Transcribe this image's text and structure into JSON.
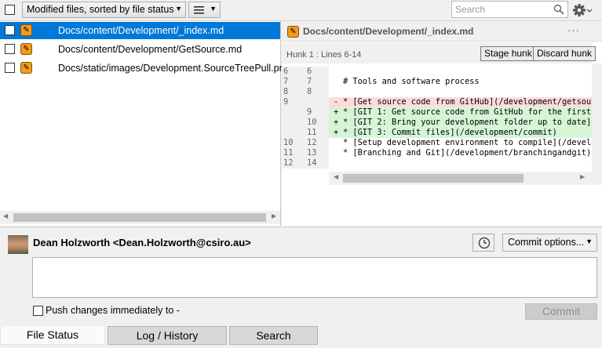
{
  "toolbar": {
    "filter_label": "Modified files, sorted by file status",
    "view_mode_icon": "list-icon",
    "search_placeholder": "Search",
    "settings_icon": "gear-icon"
  },
  "files": [
    {
      "path": "Docs/content/Development/_index.md",
      "status": "modified",
      "selected": true
    },
    {
      "path": "Docs/content/Development/GetSource.md",
      "status": "modified",
      "selected": false
    },
    {
      "path": "Docs/static/images/Development.SourceTreePull.png",
      "status": "modified",
      "selected": false
    }
  ],
  "diff": {
    "file_path": "Docs/content/Development/_index.md",
    "more_label": "···",
    "hunk_label": "Hunk 1 : Lines 6-14",
    "stage_hunk_label": "Stage hunk",
    "discard_hunk_label": "Discard hunk",
    "lines": [
      {
        "old": "6",
        "new": "6",
        "marker": "",
        "type": "context",
        "text": ""
      },
      {
        "old": "7",
        "new": "7",
        "marker": "",
        "type": "context",
        "text": "# Tools and software process"
      },
      {
        "old": "8",
        "new": "8",
        "marker": "",
        "type": "context",
        "text": ""
      },
      {
        "old": "9",
        "new": "",
        "marker": "-",
        "type": "del",
        "text": "* [Get source code from GitHub](/development/getsour"
      },
      {
        "old": "",
        "new": "9",
        "marker": "+",
        "type": "add",
        "text": "* [GIT 1: Get source code from GitHub for the first"
      },
      {
        "old": "",
        "new": "10",
        "marker": "+",
        "type": "add",
        "text": "* [GIT 2: Bring your development folder up to date]("
      },
      {
        "old": "",
        "new": "11",
        "marker": "+",
        "type": "add",
        "text": "* [GIT 3: Commit files](/development/commit)"
      },
      {
        "old": "10",
        "new": "12",
        "marker": "",
        "type": "context",
        "text": "* [Setup development environment to compile](/develo"
      },
      {
        "old": "11",
        "new": "13",
        "marker": "",
        "type": "context",
        "text": "* [Branching and Git](/development/branchingandgit)"
      },
      {
        "old": "12",
        "new": "14",
        "marker": "",
        "type": "context",
        "text": ""
      }
    ]
  },
  "commit": {
    "author": "Dean Holzworth <Dean.Holzworth@csiro.au>",
    "history_icon": "clock-icon",
    "options_label": "Commit options...",
    "message_value": "",
    "push_label": "Push changes immediately to -",
    "commit_button_label": "Commit"
  },
  "tabs": [
    {
      "label": "File Status",
      "active": true
    },
    {
      "label": "Log / History",
      "active": false
    },
    {
      "label": "Search",
      "active": false
    }
  ]
}
